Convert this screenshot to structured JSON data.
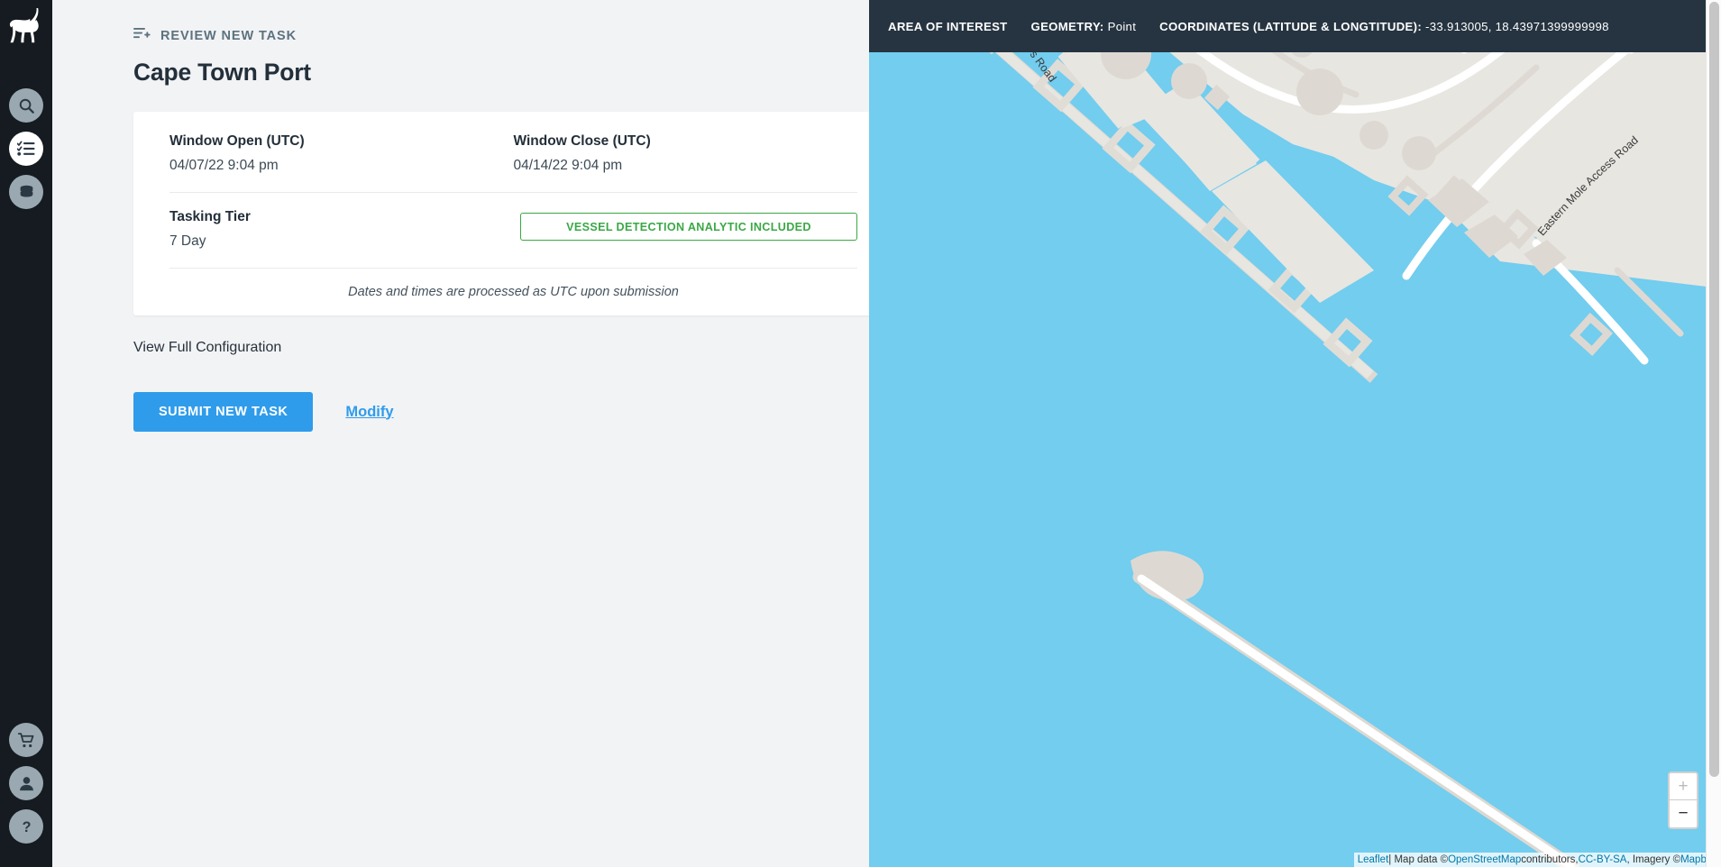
{
  "sidebar": {
    "logo_name": "capella-ibex-logo",
    "items_top": [
      {
        "name": "search",
        "icon": "search-icon",
        "active": false
      },
      {
        "name": "tasks",
        "icon": "checklist-icon",
        "active": true
      },
      {
        "name": "data",
        "icon": "database-icon",
        "active": false
      }
    ],
    "items_bottom": [
      {
        "name": "cart",
        "icon": "shopping-cart-icon"
      },
      {
        "name": "account",
        "icon": "user-icon"
      },
      {
        "name": "help",
        "icon": "question-mark-icon"
      }
    ]
  },
  "panel": {
    "breadcrumb": "REVIEW NEW TASK",
    "breadcrumb_icon": "add-to-list-icon",
    "title": "Cape Town Port",
    "card": {
      "window_open_label": "Window Open (UTC)",
      "window_open_value": "04/07/22 9:04 pm",
      "window_close_label": "Window Close (UTC)",
      "window_close_value": "04/14/22 9:04 pm",
      "tasking_tier_label": "Tasking Tier",
      "tasking_tier_value": "7 Day",
      "analytic_badge": "VESSEL DETECTION ANALYTIC INCLUDED",
      "note": "Dates and times are processed as UTC upon submission"
    },
    "view_full_configuration": "View Full Configuration",
    "chevron_icon": "chevron-down-icon",
    "submit_button": "SUBMIT NEW TASK",
    "modify_link": "Modify"
  },
  "map": {
    "header": {
      "area_of_interest": "AREA OF INTEREST",
      "geometry_key": "GEOMETRY:",
      "geometry_value": "Point",
      "coordinates_key": "COORDINATES (LATITUDE & LONGTITUDE):",
      "coordinates_value": "-33.913005, 18.43971399999998"
    },
    "marker_icon": "map-pin-marker",
    "zoom_in": "+",
    "zoom_out": "−",
    "labels": {
      "road_partial": "s Road",
      "eastern_mole": "Eastern Mole Access Road"
    },
    "attribution": {
      "leaflet": "Leaflet",
      "sep1": " | Map data © ",
      "osm": "OpenStreetMap",
      "sep2": " contributors, ",
      "license": "CC-BY-SA",
      "sep3": ", Imagery © ",
      "mapbox": "Mapbox"
    }
  },
  "colors": {
    "accent_blue": "#2f9ceb",
    "success_green": "#3aa845",
    "rail_dark": "#151b20",
    "header_dark": "#263441",
    "water": "#72cdef",
    "land": "#e8e6e1"
  }
}
